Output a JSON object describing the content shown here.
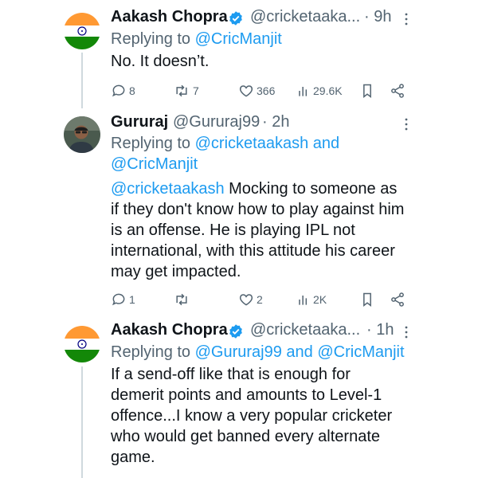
{
  "tweets": [
    {
      "name": "Aakash Chopra",
      "handle": "@cricketaaka...",
      "time": "· 9h",
      "replying_prefix": "Replying to ",
      "replying_to": "@CricManjit",
      "text": "No. It doesn’t.",
      "actions": {
        "replies": "8",
        "retweets": "7",
        "likes": "366",
        "views": "29.6K"
      }
    },
    {
      "name": "Gururaj",
      "handle": "@Gururaj99",
      "time": "· 2h",
      "replying_prefix": "Replying to ",
      "replying_to_line1": "@cricketaakash and",
      "replying_to_line2": "@CricManjit",
      "mention": "@cricketaakash",
      "text": " Mocking to someone as\nif they don't know how to play against him\nis an offense. He is playing IPL not\ninternational, with this attitude his career\nmay get impacted.",
      "actions": {
        "replies": "1",
        "retweets": "",
        "likes": "2",
        "views": "2K"
      }
    },
    {
      "name": "Aakash Chopra",
      "handle": "@cricketaaka...",
      "time": "· 1h",
      "replying_prefix": "Replying to ",
      "replying_to": "@Gururaj99 and @CricManjit",
      "text": "If a send-off like that is enough for\ndemerit points and amounts to Level-1\noffence...I know a very popular cricketer\nwho would get banned every alternate\ngame.",
      "actions": {}
    }
  ],
  "colors": {
    "link": "#1d9bf0",
    "secondary": "#536471",
    "verified": "#1d9bf0"
  }
}
